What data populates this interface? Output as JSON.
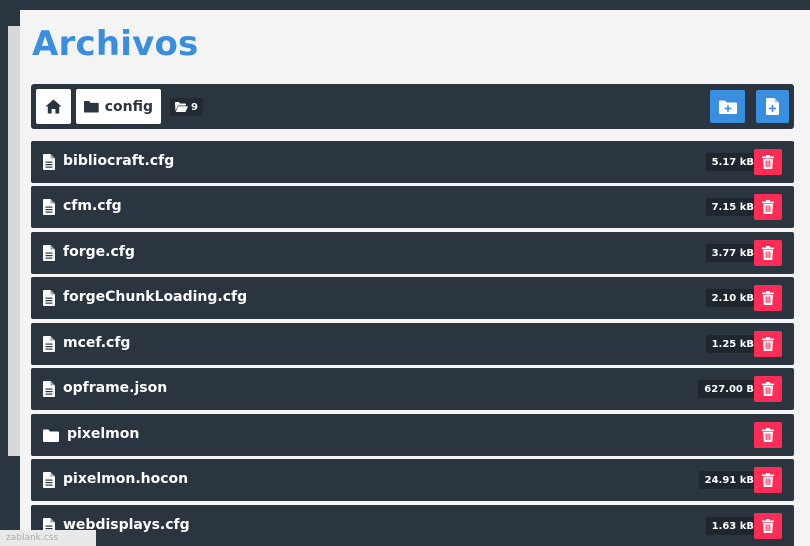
{
  "page": {
    "title": "Archivos"
  },
  "toolbar": {
    "current_folder": "config",
    "item_count": "9",
    "icons": {
      "home": "home-icon",
      "folder": "folder-icon",
      "count": "folder-open-icon",
      "new_folder": "folder-plus-icon",
      "new_file": "file-plus-icon"
    }
  },
  "files": [
    {
      "type": "file",
      "name": "bibliocraft.cfg",
      "size": "5.17 kB"
    },
    {
      "type": "file",
      "name": "cfm.cfg",
      "size": "7.15 kB"
    },
    {
      "type": "file",
      "name": "forge.cfg",
      "size": "3.77 kB"
    },
    {
      "type": "file",
      "name": "forgeChunkLoading.cfg",
      "size": "2.10 kB"
    },
    {
      "type": "file",
      "name": "mcef.cfg",
      "size": "1.25 kB"
    },
    {
      "type": "file",
      "name": "opframe.json",
      "size": "627.00 B"
    },
    {
      "type": "folder",
      "name": "pixelmon",
      "size": ""
    },
    {
      "type": "file",
      "name": "pixelmon.hocon",
      "size": "24.91 kB"
    },
    {
      "type": "file",
      "name": "webdisplays.cfg",
      "size": "1.63 kB"
    }
  ],
  "colors": {
    "dark": "#2b3540",
    "accent_blue": "#3a8ee0",
    "delete_red": "#ff2d55",
    "panel_bg": "#f4f4f4"
  },
  "status_fragment": "zablank.css"
}
